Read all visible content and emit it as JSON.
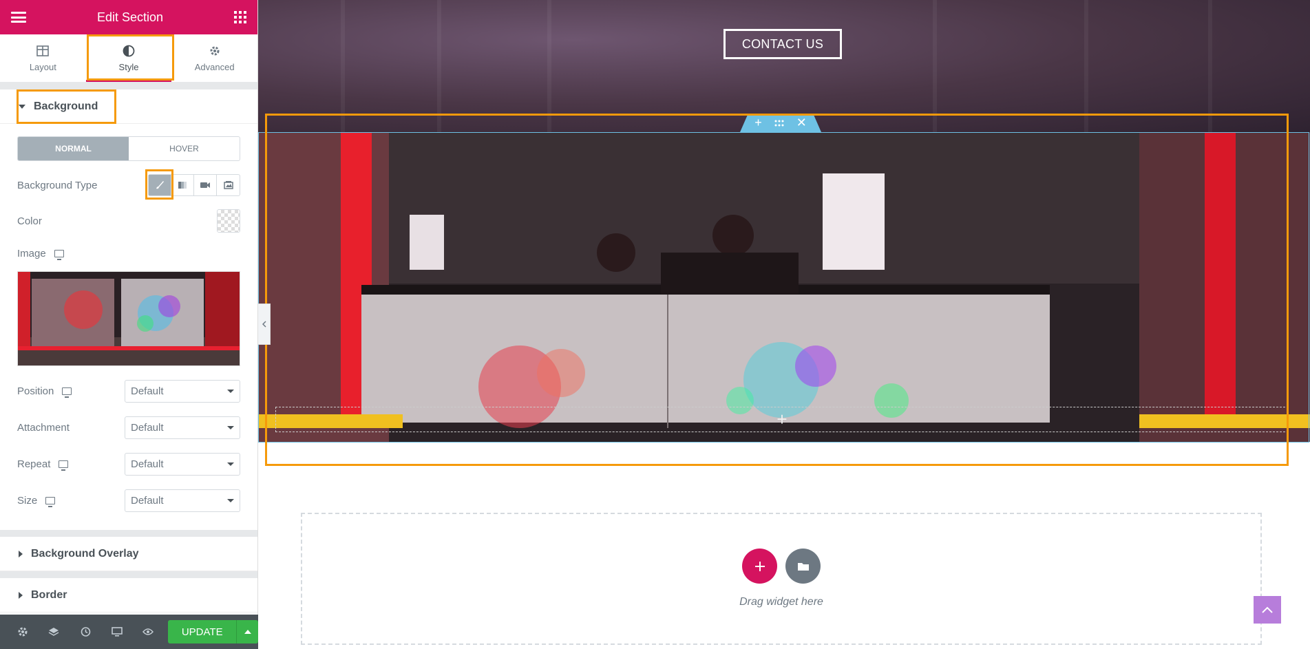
{
  "panel": {
    "title": "Edit Section",
    "tabs": [
      {
        "label": "Layout"
      },
      {
        "label": "Style"
      },
      {
        "label": "Advanced"
      }
    ],
    "background_section": {
      "title": "Background",
      "state_toggle": {
        "normal": "NORMAL",
        "hover": "HOVER",
        "selected": "NORMAL"
      },
      "background_type_label": "Background Type",
      "background_type_options": [
        "classic",
        "gradient",
        "video",
        "slideshow"
      ],
      "background_type_selected": "classic",
      "color_label": "Color",
      "image_label": "Image",
      "position": {
        "label": "Position",
        "value": "Default"
      },
      "attachment": {
        "label": "Attachment",
        "value": "Default"
      },
      "repeat": {
        "label": "Repeat",
        "value": "Default"
      },
      "size": {
        "label": "Size",
        "value": "Default"
      }
    },
    "collapsed_sections": [
      "Background Overlay",
      "Border"
    ],
    "footer": {
      "update_label": "UPDATE",
      "icons": [
        "settings-icon",
        "layers-icon",
        "history-icon",
        "responsive-icon",
        "preview-icon"
      ]
    }
  },
  "canvas": {
    "contact_button": "CONTACT US",
    "section_handle_icons": [
      "add-icon",
      "drag-icon",
      "close-icon"
    ],
    "drop_zone_text": "Drag widget here"
  },
  "colors": {
    "brand": "#d5135f",
    "highlight": "#f59a0b",
    "section_outline": "#6ec1e4",
    "update": "#39b54a",
    "scroll_top": "#b77ddb"
  }
}
